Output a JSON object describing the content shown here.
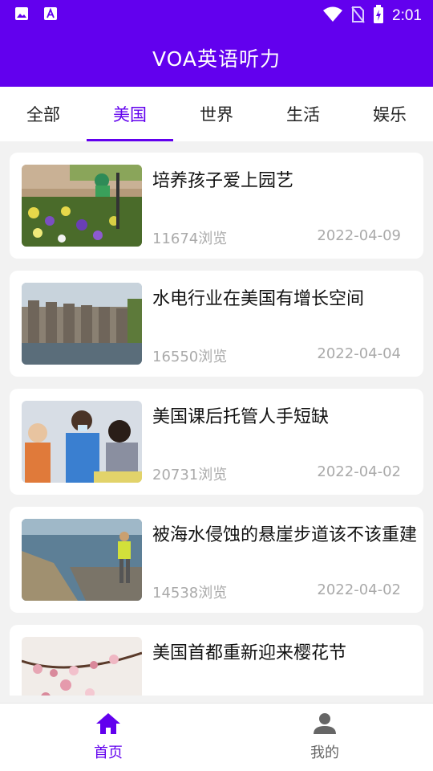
{
  "status_bar": {
    "time": "2:01",
    "icons": [
      "image-icon",
      "a-text-icon",
      "wifi-icon",
      "no-sim-icon",
      "battery-icon"
    ]
  },
  "app_bar": {
    "title": "VOA英语听力"
  },
  "tabs": [
    {
      "label": "全部",
      "selected": false
    },
    {
      "label": "美国",
      "selected": true
    },
    {
      "label": "世界",
      "selected": false
    },
    {
      "label": "生活",
      "selected": false
    },
    {
      "label": "娱乐",
      "selected": false
    }
  ],
  "articles": [
    {
      "title": "培养孩子爱上园艺",
      "views": "11674浏览",
      "date": "2022-04-09",
      "thumbnail": "garden-photo"
    },
    {
      "title": "水电行业在美国有增长空间",
      "views": "16550浏览",
      "date": "2022-04-04",
      "thumbnail": "dam-photo"
    },
    {
      "title": "美国课后托管人手短缺",
      "views": "20731浏览",
      "date": "2022-04-02",
      "thumbnail": "classroom-photo"
    },
    {
      "title": "被海水侵蚀的悬崖步道该不该重建",
      "views": "14538浏览",
      "date": "2022-04-02",
      "thumbnail": "cliff-photo"
    },
    {
      "title": "美国首都重新迎来樱花节",
      "views": "",
      "date": "",
      "thumbnail": "cherry-blossom-photo"
    }
  ],
  "bottom_nav": [
    {
      "label": "首页",
      "icon": "home-icon",
      "selected": true
    },
    {
      "label": "我的",
      "icon": "person-icon",
      "selected": false
    }
  ],
  "colors": {
    "primary": "#6200ee",
    "meta_text": "#aaaaaa",
    "background": "#f2f2f2"
  }
}
